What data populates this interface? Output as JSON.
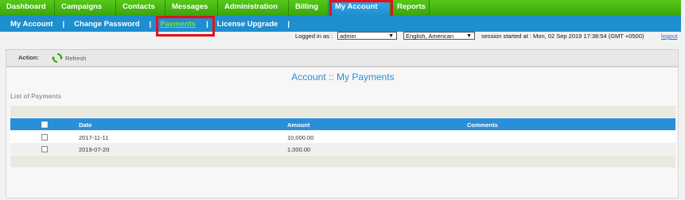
{
  "topnav": {
    "items": [
      "Dashboard",
      "Campaigns",
      "Contacts",
      "Messages",
      "Administration",
      "Billing",
      "My Account",
      "Reports"
    ],
    "active": "My Account"
  },
  "subnav": {
    "items": [
      "My Account",
      "Change Password",
      "Payments",
      "License Upgrade"
    ],
    "active": "Payments"
  },
  "status": {
    "logged_in_label": "Logged in as :",
    "user": "admin",
    "language": "English, American",
    "session": "session started at : Mon, 02 Sep 2019 17:38:54 (GMT +0500)",
    "logout": "logout"
  },
  "action": {
    "label": "Action:",
    "refresh": "Refresh"
  },
  "page": {
    "title": "Account :: My Payments",
    "list_label": "List of Payments"
  },
  "table": {
    "columns": [
      "Date",
      "Amount",
      "Comments"
    ],
    "rows": [
      {
        "date": "2017-11-11",
        "amount": "10,000.00",
        "comments": ""
      },
      {
        "date": "2019-07-20",
        "amount": "1,000.00",
        "comments": ""
      }
    ]
  },
  "colors": {
    "nav_green": "#3aa30c",
    "nav_blue": "#1f8ecf",
    "highlight_red": "#e3111b",
    "title_blue": "#2a8fd8"
  }
}
